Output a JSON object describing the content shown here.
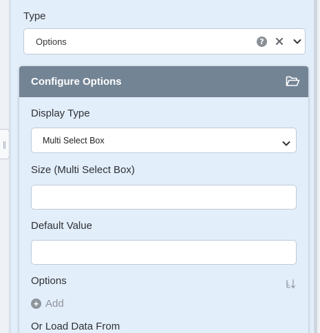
{
  "type_field": {
    "label": "Type",
    "value": "Options",
    "icons": [
      "help-icon",
      "clear-icon",
      "chevron-down-icon"
    ]
  },
  "configure_options": {
    "title": "Configure Options",
    "header_icon": "folder-open-icon",
    "display_type": {
      "label": "Display Type",
      "value": "Multi Select Box"
    },
    "size": {
      "label": "Size (Multi Select Box)",
      "value": ""
    },
    "default_value": {
      "label": "Default Value",
      "value": ""
    },
    "options": {
      "label": "Options",
      "add_label": "Add",
      "sort_icon": "sort-icon"
    },
    "load_data_from": {
      "label": "Or Load Data From"
    }
  },
  "colors": {
    "panel_bg": "#e3eefb",
    "header_bg": "#738495",
    "border": "#bfcad6"
  }
}
